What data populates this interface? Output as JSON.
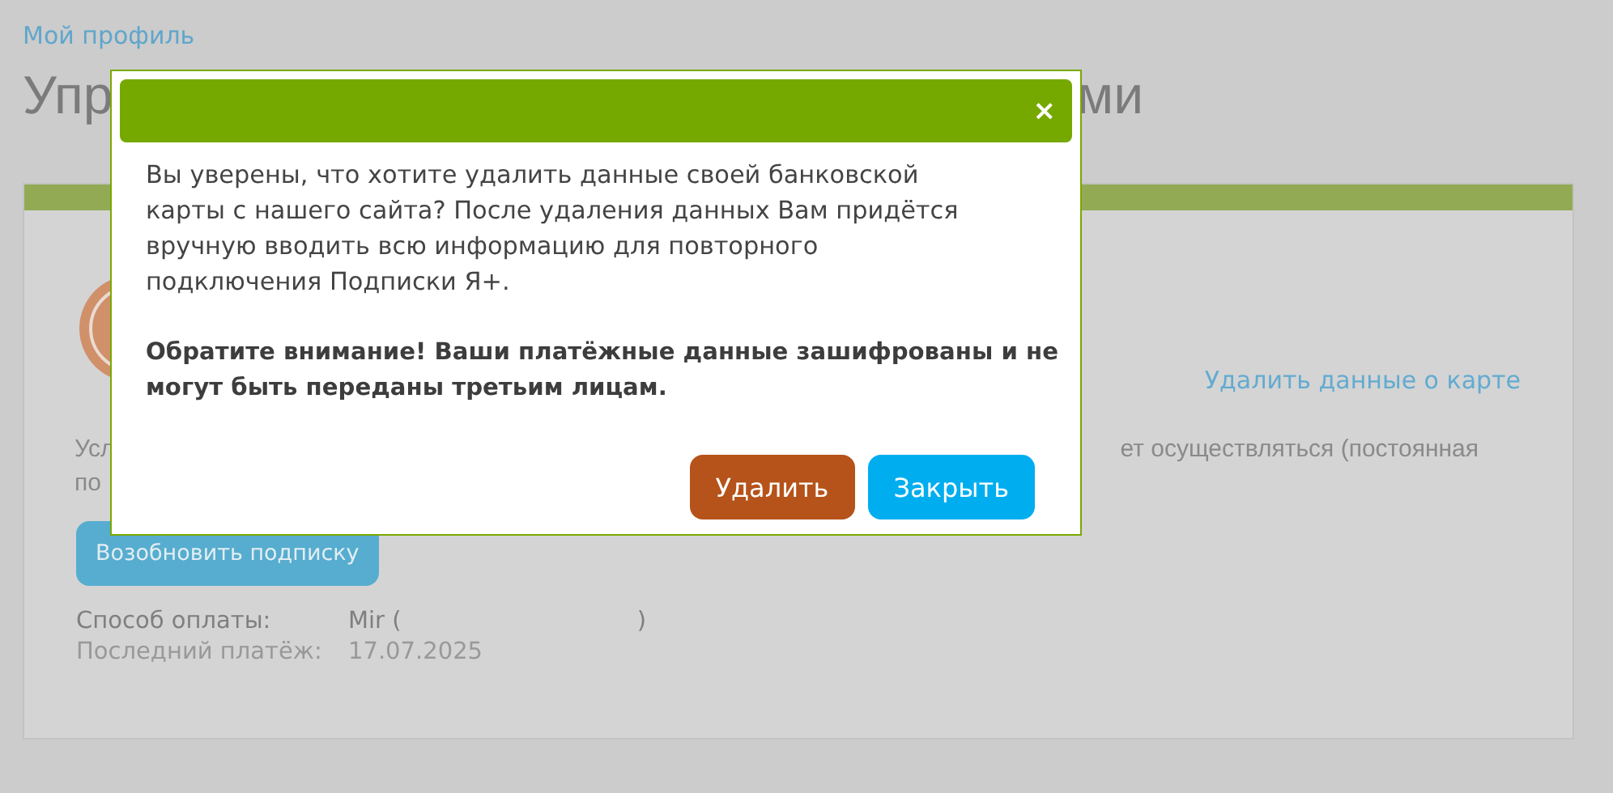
{
  "breadcrumb": "Мой профиль",
  "page_title": {
    "visible_left": "Упр",
    "visible_right": "ми"
  },
  "card": {
    "delete_card_link": "Удалить данные о карте",
    "notice": {
      "line_1_left": "Усл",
      "line_2_left": "по",
      "line_1_right": "ет осуществляться (постоянная"
    },
    "renew_button": "Возобновить подписку",
    "details": [
      {
        "label": "Способ оплаты:",
        "value": "Mir (",
        "value_end": ")"
      },
      {
        "label": "Последний платёж:",
        "value": "17.07.2025"
      }
    ]
  },
  "dialog": {
    "close": "×",
    "message": "Вы уверены, что хотите удалить данные своей банковской карты с нашего сайта? После удаления данных Вам придётся вручную вводить всю информацию для повторного подключения Подписки Я+.",
    "warning": "Обратите внимание! Ваши платёжные данные зашифрованы и не могут быть переданы третьим лицам.",
    "buttons": [
      {
        "label": "Удалить",
        "kind": "danger"
      },
      {
        "label": "Закрыть",
        "kind": "primary"
      }
    ]
  }
}
